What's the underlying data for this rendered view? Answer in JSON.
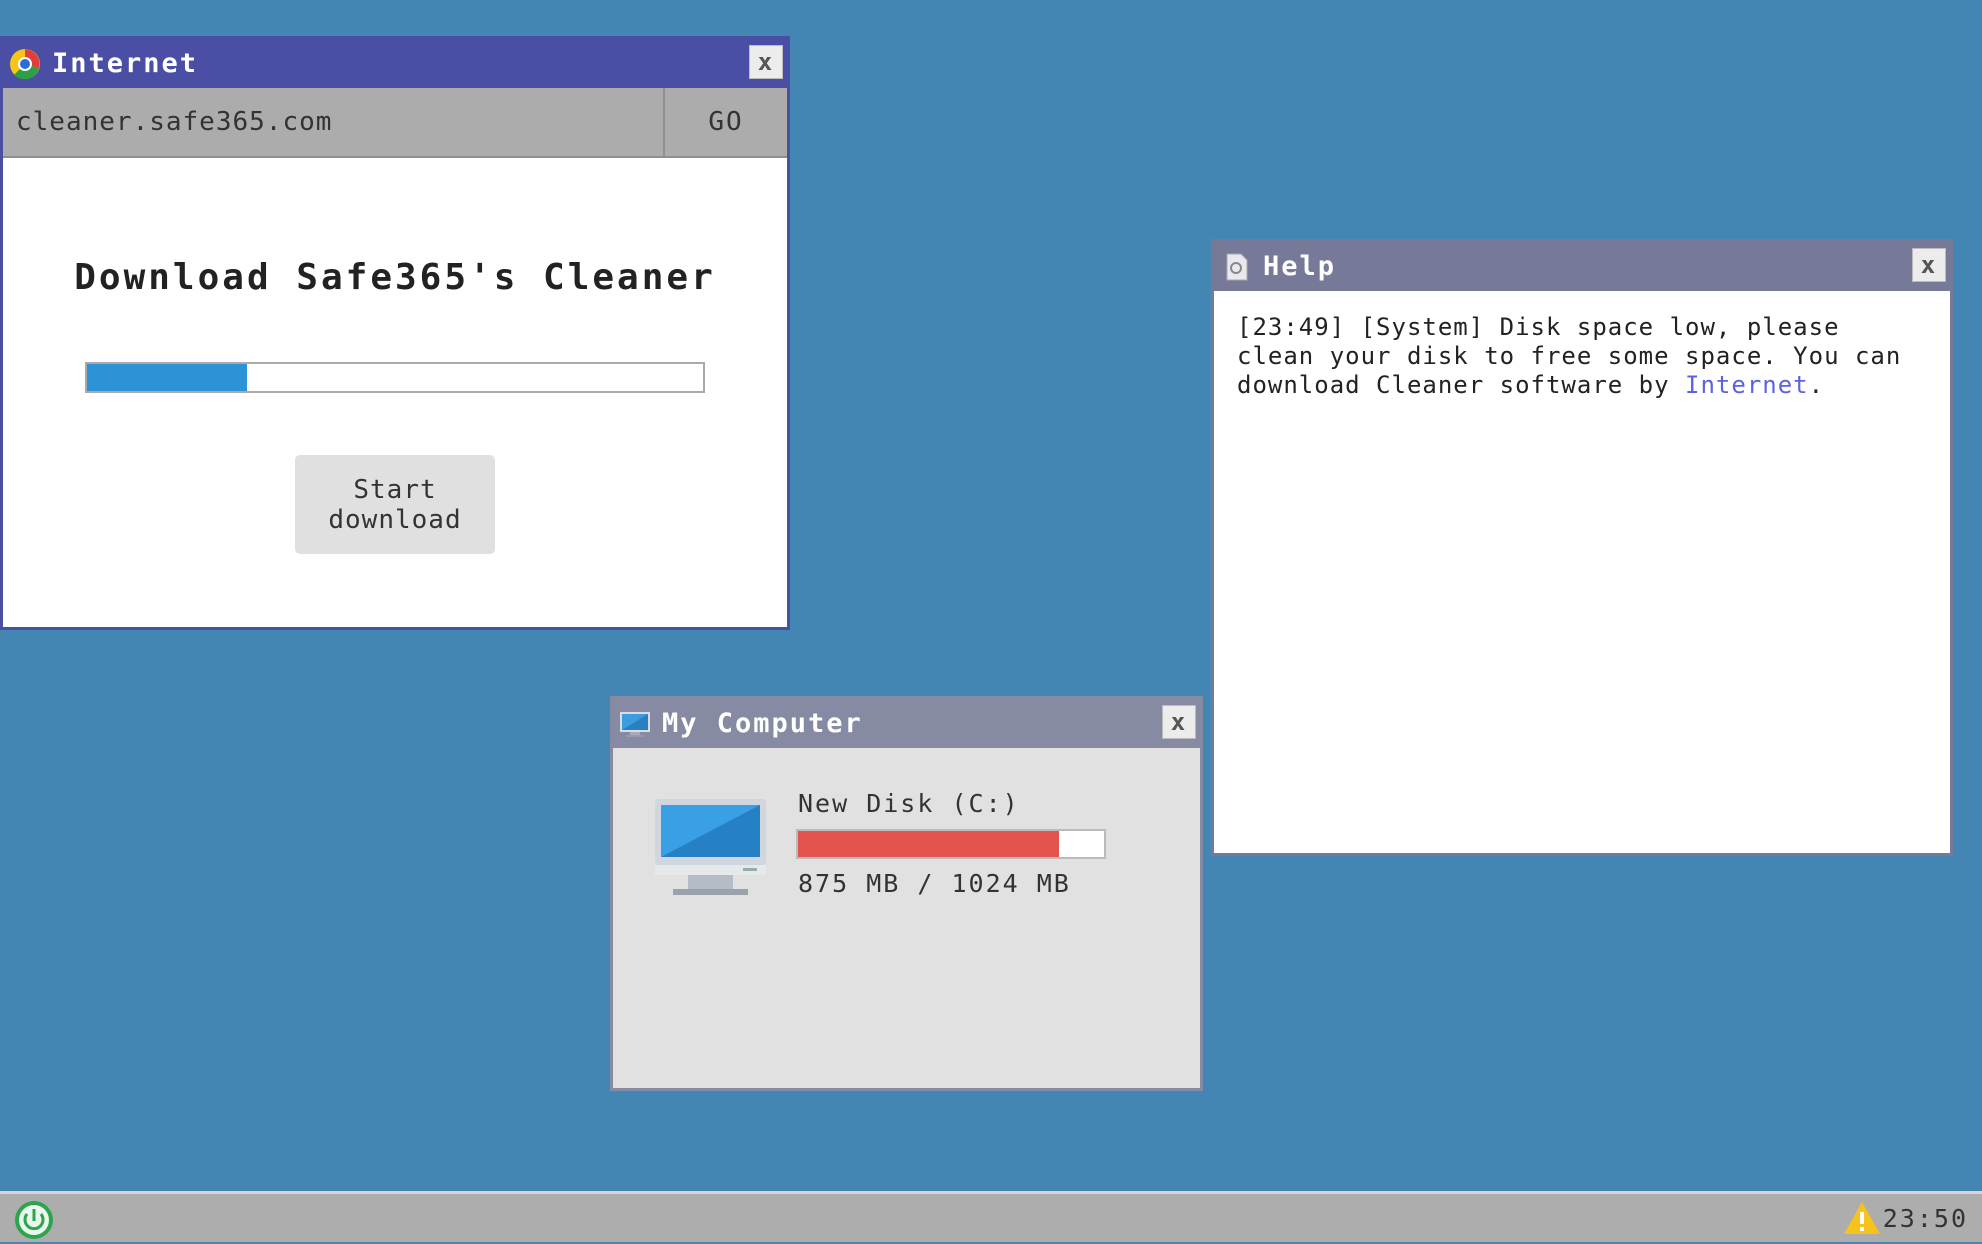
{
  "colors": {
    "desktop": "#4386b3",
    "internet_titlebar": "#4a4fa5",
    "help_titlebar": "#767997",
    "mycomputer_titlebar": "#878aa3",
    "download_progress": "#2b93d6",
    "disk_usage_bar": "#e4544f",
    "link": "#5c62e0"
  },
  "internet_window": {
    "title": "Internet",
    "icon": "browser-logo-icon",
    "close_label": "x",
    "url": "cleaner.safe365.com",
    "go_label": "GO",
    "heading": "Download Safe365's Cleaner",
    "download_progress_percent": 26,
    "start_button_label": "Start download"
  },
  "help_window": {
    "title": "Help",
    "icon": "document-icon",
    "close_label": "x",
    "message_text": "[23:49] [System] Disk space low, please clean your disk to free some space. You can download Cleaner software by ",
    "link_text": "Internet",
    "message_end": "."
  },
  "mycomputer_window": {
    "title": "My Computer",
    "icon": "computer-icon",
    "close_label": "x",
    "disk_label": "New Disk (C:)",
    "disk_used_mb": 875,
    "disk_total_mb": 1024,
    "disk_usage_text": "875 MB / 1024 MB"
  },
  "taskbar": {
    "power_icon": "power-icon",
    "warning_icon": "warning-icon",
    "clock": "23:50"
  }
}
